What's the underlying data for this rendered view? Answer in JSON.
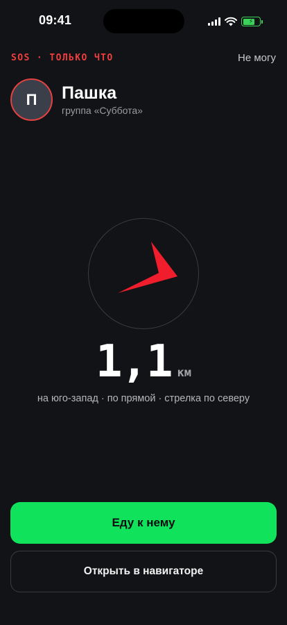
{
  "status_bar": {
    "time": "09:41",
    "icons": [
      "signal-icon",
      "wifi-icon",
      "battery-charging-icon"
    ],
    "battery_color": "#3ad35a",
    "battery_level": 0.7
  },
  "alert": {
    "tag": "SOS · ТОЛЬКО ЧТО",
    "tag_color": "#ef3e3e",
    "decline_label": "Не могу"
  },
  "person": {
    "initial": "П",
    "name": "Пашка",
    "group": "группа «Суббота»",
    "avatar_ring_color": "#e54141"
  },
  "compass": {
    "arrow_icon": "direction-arrow-icon",
    "arrow_color": "#f01e2c",
    "bearing": "юго-запад"
  },
  "distance": {
    "value": "1,1",
    "unit": "км",
    "caption": "на юго-запад · по прямой · стрелка по северу"
  },
  "actions": {
    "primary_label": "Еду к нему",
    "primary_color": "#10e25b",
    "secondary_label": "Открыть в навигаторе"
  }
}
